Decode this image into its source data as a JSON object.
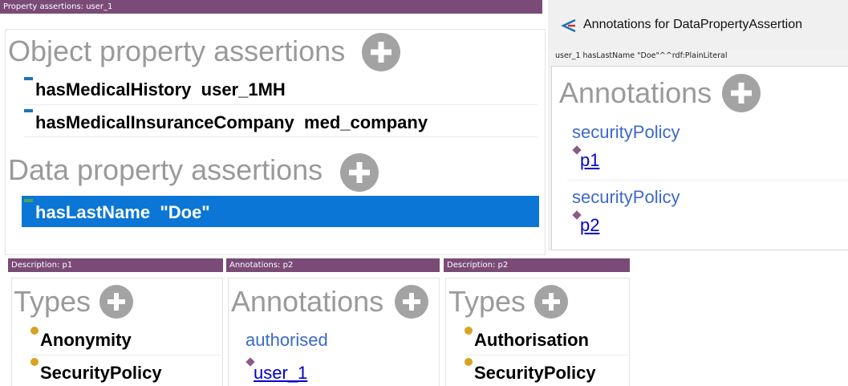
{
  "property_assertions_panel": {
    "header": "Property assertions: user_1",
    "object_section_title": "Object property assertions",
    "object_rows": [
      {
        "property": "hasMedicalHistory",
        "value": "user_1MH"
      },
      {
        "property": "hasMedicalInsuranceCompany",
        "value": "med_company"
      }
    ],
    "data_section_title": "Data property assertions",
    "data_rows": [
      {
        "property": "hasLastName",
        "value": "\"Doe\"",
        "selected": true
      }
    ]
  },
  "annotations_dialog": {
    "title": "Annotations for DataPropertyAssertion",
    "subject": "user_1 hasLastName \"Doe\"^^rdf:PlainLiteral",
    "section_title": "Annotations",
    "items": [
      {
        "property": "securityPolicy",
        "value": "p1"
      },
      {
        "property": "securityPolicy",
        "value": "p2"
      }
    ]
  },
  "description_p1": {
    "header": "Description: p1",
    "section_title": "Types",
    "rows": [
      "Anonymity",
      "SecurityPolicy"
    ]
  },
  "annotations_p2": {
    "header": "Annotations: p2",
    "section_title": "Annotations",
    "items": [
      {
        "property": "authorised",
        "value": "user_1"
      }
    ]
  },
  "description_p2": {
    "header": "Description: p2",
    "section_title": "Types",
    "rows": [
      "Authorisation",
      "SecurityPolicy"
    ]
  },
  "colors": {
    "header_bar": "#7b4b78",
    "selection": "#0b76d6",
    "object_property_icon": "#1b73b8",
    "data_property_icon": "#4aa35a",
    "class_icon": "#d9a321",
    "individual_icon": "#8b5a86",
    "annotation_property": "#3c69c9",
    "link": "#0000cc"
  }
}
